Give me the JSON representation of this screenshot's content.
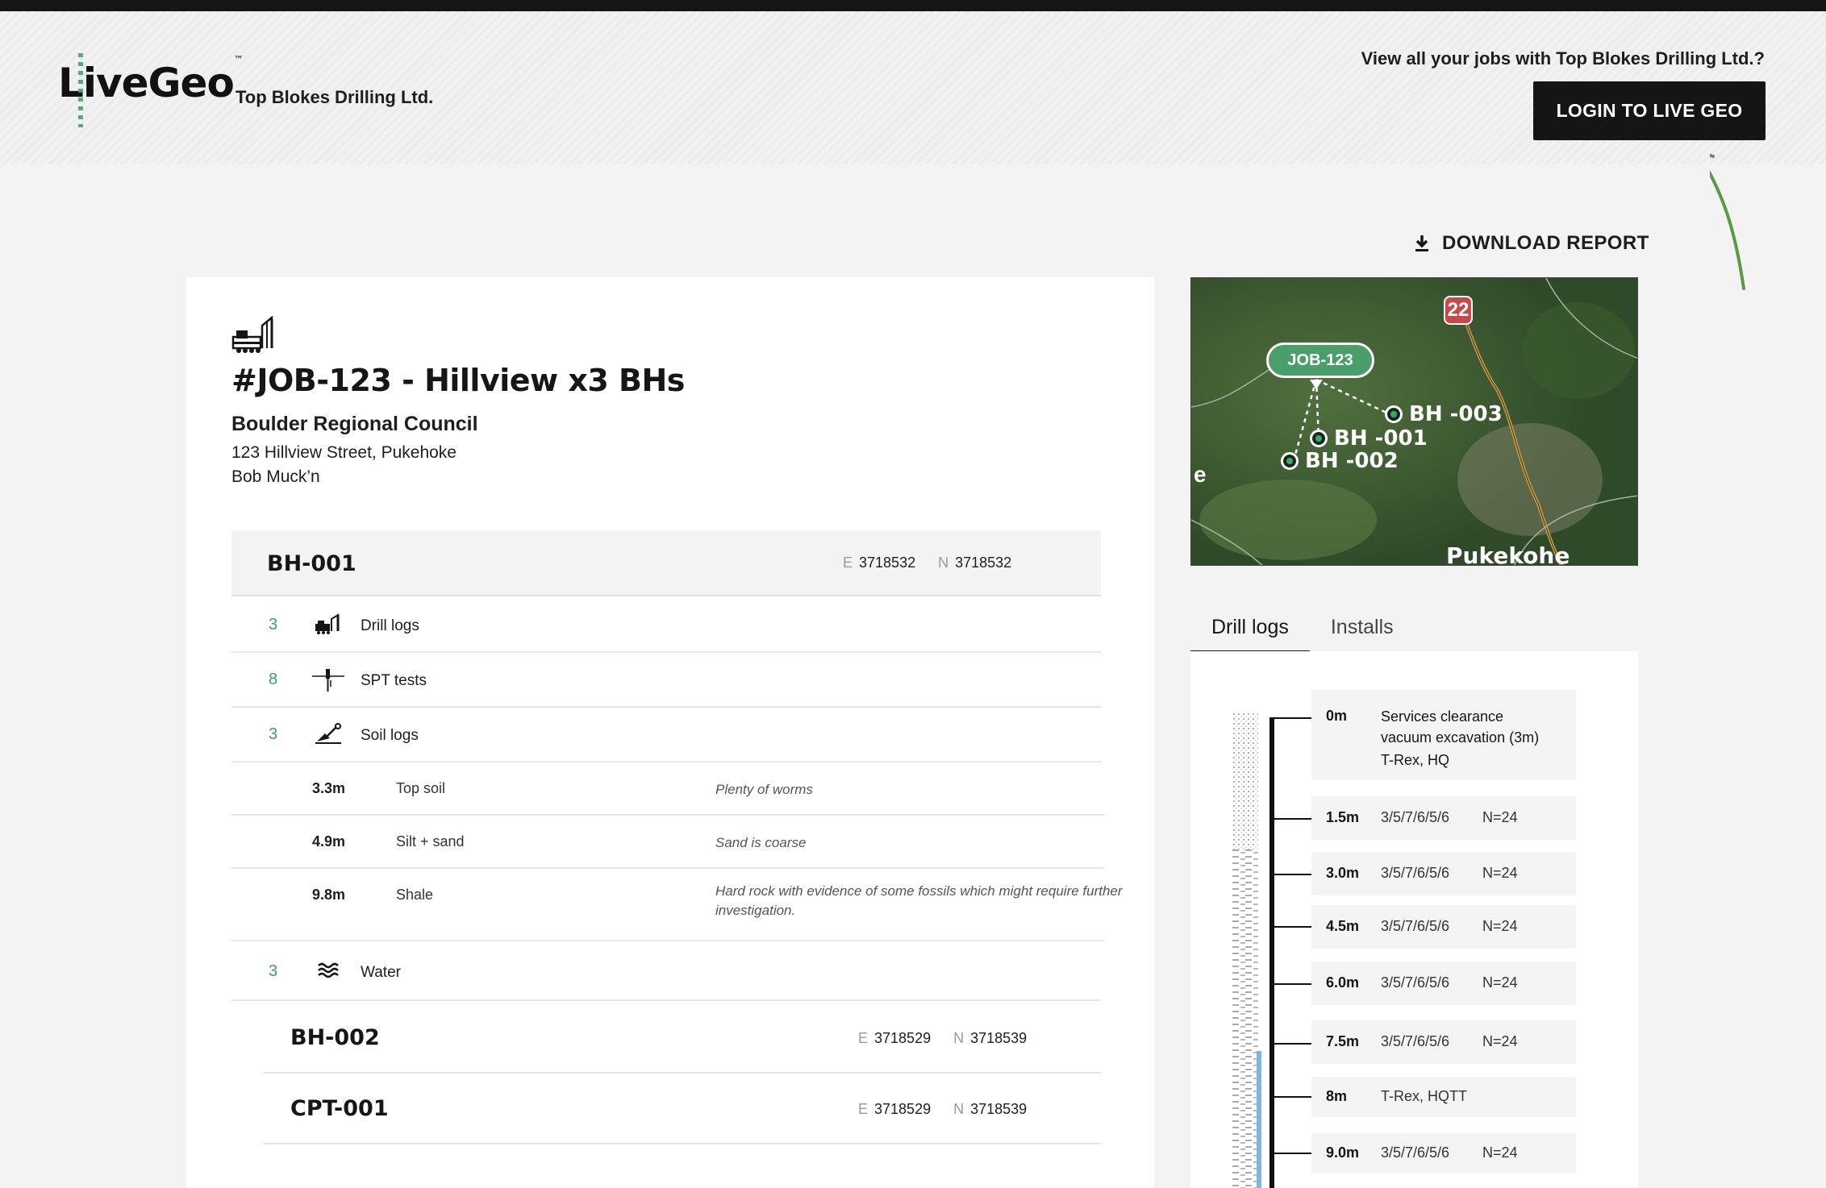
{
  "header": {
    "logo_text": "LiveGeo",
    "trademark": "™",
    "company": "Top Blokes Drilling Ltd.",
    "view_jobs_text": "View all your jobs with Top Blokes Drilling Ltd.?",
    "login_label": "LOGIN TO LIVE GEO"
  },
  "download_label": "DOWNLOAD REPORT",
  "job": {
    "title": "#JOB-123 -  Hillview x3 BHs",
    "client": "Boulder Regional Council",
    "address": "123 Hillview Street, Pukehoke",
    "contact": "Bob Muck’n"
  },
  "boreholes": [
    {
      "name": "BH-001",
      "e_label": "E",
      "e": "3718532",
      "n_label": "N",
      "n": "3718532",
      "records": [
        {
          "count": "3",
          "label": "Drill logs",
          "icon": "drill-rig-icon"
        },
        {
          "count": "8",
          "label": "SPT tests",
          "icon": "spt-test-icon"
        },
        {
          "count": "3",
          "label": "Soil logs",
          "icon": "shovel-icon"
        },
        {
          "count": "3",
          "label": "Water",
          "icon": "water-waves-icon"
        }
      ],
      "soil_logs": [
        {
          "depth": "3.3m",
          "type": "Top soil",
          "note": "Plenty of worms"
        },
        {
          "depth": "4.9m",
          "type": "Silt + sand",
          "note": "Sand is coarse"
        },
        {
          "depth": "9.8m",
          "type": "Shale",
          "note": "Hard rock with evidence of some fossils which might require further investigation."
        }
      ]
    },
    {
      "name": "BH-002",
      "e_label": "E",
      "e": "3718529",
      "n_label": "N",
      "n": "3718539"
    },
    {
      "name": "CPT-001",
      "e_label": "E",
      "e": "3718529",
      "n_label": "N",
      "n": "3718539"
    }
  ],
  "map": {
    "job_label": "JOB-123",
    "pins": [
      "BH -003",
      "BH -001",
      "BH -002"
    ],
    "road_number": "22",
    "place": "Pukekohe",
    "edge_letter": "e"
  },
  "tabs": [
    "Drill logs",
    "Installs"
  ],
  "drill_log": [
    {
      "depth": "0m",
      "lines": [
        "Services clearance",
        "vacuum excavation (3m)",
        "T-Rex, HQ"
      ]
    },
    {
      "depth": "1.5m",
      "value": "3/5/7/6/5/6",
      "n": "N=24"
    },
    {
      "depth": "3.0m",
      "value": "3/5/7/6/5/6",
      "n": "N=24"
    },
    {
      "depth": "4.5m",
      "value": "3/5/7/6/5/6",
      "n": "N=24"
    },
    {
      "depth": "6.0m",
      "value": "3/5/7/6/5/6",
      "n": "N=24"
    },
    {
      "depth": "7.5m",
      "value": "3/5/7/6/5/6",
      "n": "N=24"
    },
    {
      "depth": "8m",
      "value": "T-Rex, HQTT"
    },
    {
      "depth": "9.0m",
      "value": "3/5/7/6/5/6",
      "n": "N=24"
    }
  ]
}
